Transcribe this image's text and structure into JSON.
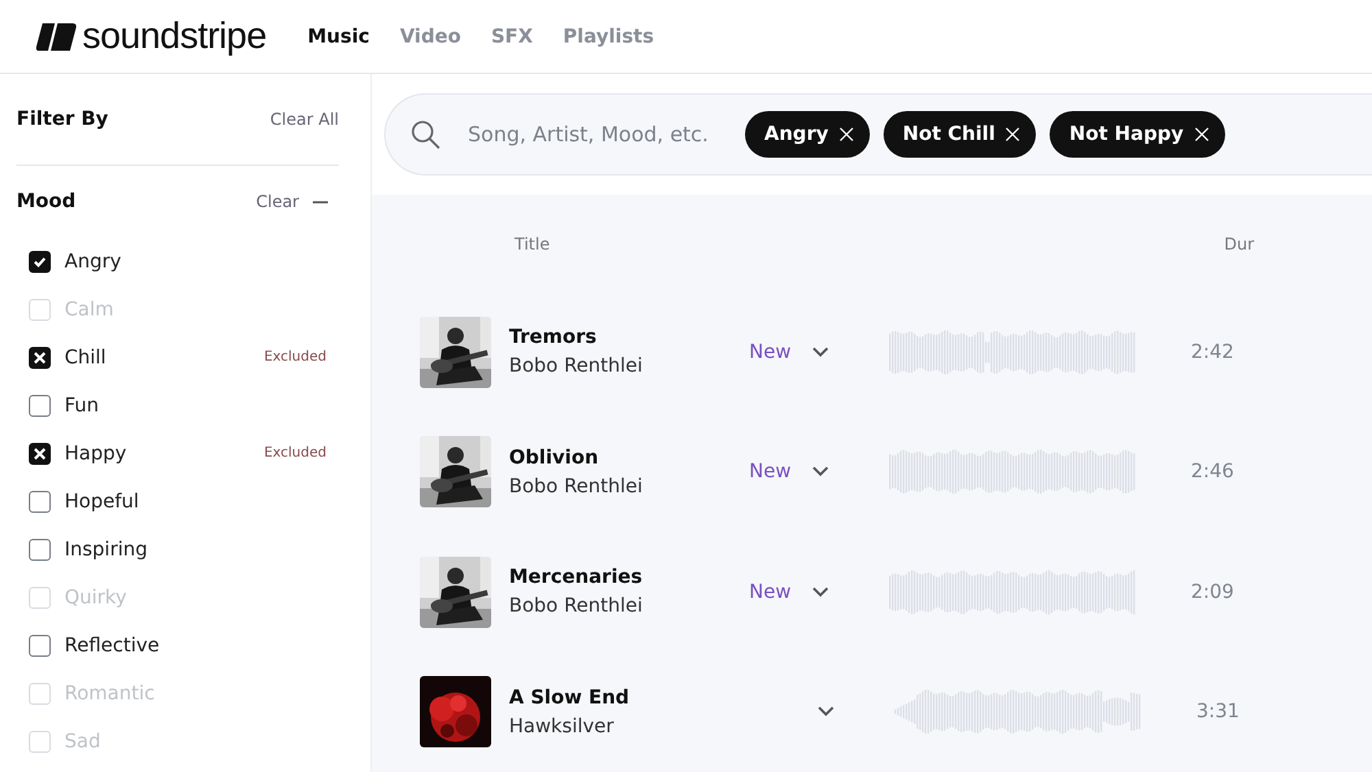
{
  "header": {
    "logo": "soundstripe",
    "nav": [
      {
        "label": "Music",
        "selected": true
      },
      {
        "label": "Video",
        "selected": false
      },
      {
        "label": "SFX",
        "selected": false
      },
      {
        "label": "Playlists",
        "selected": false
      }
    ]
  },
  "sidebar": {
    "title": "Filter By",
    "clear_all": "Clear All",
    "section": {
      "title": "Mood",
      "clear": "Clear",
      "expanded": true,
      "items": [
        {
          "label": "Angry",
          "checked": true,
          "excluded": false,
          "disabled": false
        },
        {
          "label": "Calm",
          "checked": false,
          "excluded": false,
          "disabled": true
        },
        {
          "label": "Chill",
          "checked": false,
          "excluded": true,
          "disabled": false,
          "note": "Excluded"
        },
        {
          "label": "Fun",
          "checked": false,
          "excluded": false,
          "disabled": false
        },
        {
          "label": "Happy",
          "checked": false,
          "excluded": true,
          "disabled": false,
          "note": "Excluded"
        },
        {
          "label": "Hopeful",
          "checked": false,
          "excluded": false,
          "disabled": false
        },
        {
          "label": "Inspiring",
          "checked": false,
          "excluded": false,
          "disabled": false
        },
        {
          "label": "Quirky",
          "checked": false,
          "excluded": false,
          "disabled": true
        },
        {
          "label": "Reflective",
          "checked": false,
          "excluded": false,
          "disabled": false
        },
        {
          "label": "Romantic",
          "checked": false,
          "excluded": false,
          "disabled": true
        },
        {
          "label": "Sad",
          "checked": false,
          "excluded": false,
          "disabled": true
        }
      ]
    }
  },
  "search": {
    "placeholder": "Song, Artist, Mood, etc.",
    "chips": [
      "Angry",
      "Not Chill",
      "Not Happy"
    ]
  },
  "table": {
    "columns": [
      "Title",
      "Dur"
    ],
    "rows": [
      {
        "title": "Tremors",
        "artist": "Bobo Renthlei",
        "badge": "New",
        "duration": "2:42"
      },
      {
        "title": "Oblivion",
        "artist": "Bobo Renthlei",
        "badge": "New",
        "duration": "2:46"
      },
      {
        "title": "Mercenaries",
        "artist": "Bobo Renthlei",
        "badge": "New",
        "duration": "2:09"
      },
      {
        "title": "A Slow End",
        "artist": "Hawksilver",
        "duration": "3:31"
      }
    ]
  }
}
